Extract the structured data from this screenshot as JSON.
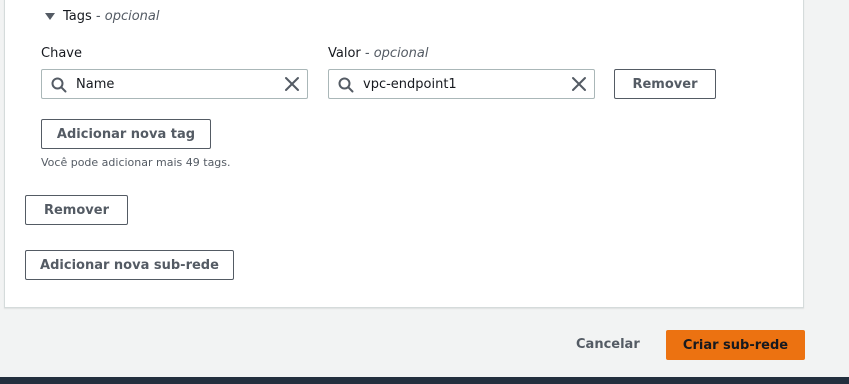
{
  "tags_section": {
    "title": "Tags",
    "title_optional": " - opcional",
    "key_label": "Chave",
    "value_label": "Valor",
    "value_optional": " - opcional",
    "key_value": "Name",
    "value_value": "vpc-endpoint1",
    "remove_tag_button": "Remover",
    "add_tag_button": "Adicionar nova tag",
    "hint": "Você pode adicionar mais 49 tags."
  },
  "subnet": {
    "remove_button": "Remover",
    "add_subnet_button": "Adicionar nova sub-rede"
  },
  "footer": {
    "cancel_label": "Cancelar",
    "create_label": "Criar sub-rede"
  },
  "colors": {
    "primary": "#ec7211",
    "border": "#aab7b8",
    "text_secondary": "#545b64",
    "bottom_bar": "#232f3e"
  },
  "icons": {
    "expander": "caret-down-icon",
    "search": "search-icon",
    "clear": "close-icon"
  }
}
